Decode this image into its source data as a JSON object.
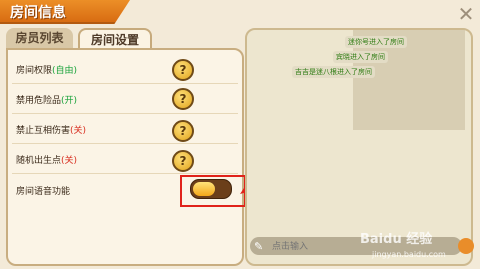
{
  "window": {
    "title": "房间信息",
    "close": "✕"
  },
  "tabs": [
    {
      "label": "房员列表"
    },
    {
      "label": "房间设置"
    }
  ],
  "settings": [
    {
      "label": "房间权限",
      "status": "(自由)",
      "status_color": "#18a23a"
    },
    {
      "label": "禁用危险品",
      "status": "(开)",
      "status_color": "#18a23a"
    },
    {
      "label": "禁止互相伤害",
      "status": "(关)",
      "status_color": "#d82d1f"
    },
    {
      "label": "随机出生点",
      "status": "(关)",
      "status_color": "#d82d1f"
    },
    {
      "label": "房间语音功能",
      "status": ""
    }
  ],
  "help_glyph": "?",
  "voice_toggle": {
    "state": "on"
  },
  "chat": {
    "messages": [
      "迷你号进入了房间",
      "宾晓进入了房间",
      "吉吉是迷八根进入了房间"
    ],
    "input_placeholder": "点击输入",
    "pencil_icon": "✎"
  },
  "watermark": {
    "brand": "Baidu 经验",
    "url": "jingyan.baidu.com"
  },
  "colors": {
    "accent": "#ec8f27",
    "highlight": "#e0221a"
  }
}
